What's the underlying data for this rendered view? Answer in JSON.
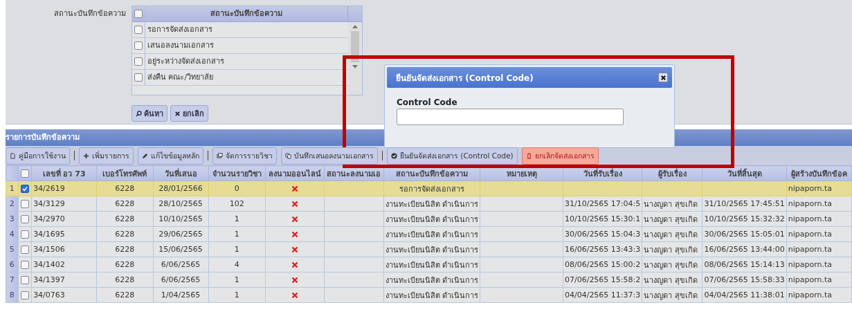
{
  "filter": {
    "label": "สถานะบันทึกข้อความ",
    "list_header": "สถานะบันทึกข้อความ",
    "header_checked": false,
    "options": [
      {
        "label": "รอการจัดส่งเอกสาร",
        "checked": false
      },
      {
        "label": "เสนอลงนามเอกสาร",
        "checked": false
      },
      {
        "label": "อยู่ระหว่างจัดส่งเอกสาร",
        "checked": false
      },
      {
        "label": "ส่งคืน คณะ/วิทยาลัย",
        "checked": false
      }
    ],
    "buttons": [
      {
        "label": "ค้นหา"
      },
      {
        "label": "ยกเลิก"
      }
    ]
  },
  "grid": {
    "title": "รายการบันทึกข้อความ",
    "toolbar": [
      {
        "kind": "button",
        "label": "คู่มือการใช้งาน"
      },
      {
        "kind": "separator"
      },
      {
        "kind": "button",
        "label": "เพิ่มรายการ"
      },
      {
        "kind": "button",
        "label": "แก้ไขข้อมูลหลัก"
      },
      {
        "kind": "separator"
      },
      {
        "kind": "button",
        "label": "จัดการรายวิชา"
      },
      {
        "kind": "button",
        "label": "บันทึกเสนอลงนามเอกสาร"
      },
      {
        "kind": "separator"
      },
      {
        "kind": "button",
        "label": "ยืนยันจัดส่งเอกสาร (Control Code)"
      },
      {
        "kind": "danger",
        "label": "ยกเลิกจัดส่งเอกสาร"
      }
    ],
    "header_checked": false,
    "columns": [
      "เลขที่ อว 73",
      "เบอร์โทรศัพท์",
      "วันที่เสนอ",
      "จำนวนรายวิชา",
      "ลงนามออนไลน์",
      "สถานะลงนามเอ",
      "สถานะบันทึกข้อความ",
      "หมายเหตุ",
      "วันที่รับเรื่อง",
      "ผู้รับเรื่อง",
      "วันที่สิ้นสุด",
      "ผู้สร้างบันทึกข้อค"
    ],
    "rows": [
      {
        "num": "1",
        "selected": true,
        "checked": true,
        "doc_no": "34/2619",
        "phone": "6228",
        "date": "28/01/2566",
        "count": "0",
        "signed_online": false,
        "status": "รอการจัดส่งเอกสาร",
        "creator": "nipaporn.ta"
      },
      {
        "num": "2",
        "selected": false,
        "checked": false,
        "doc_no": "34/3129",
        "phone": "6228",
        "date": "28/10/2565",
        "count": "102",
        "signed_online": false,
        "status": "งานทะเบียนนิสิต ดำเนินการ",
        "received": "31/10/2565 17:04:5",
        "receiver": "นางญดา สุขเกิด",
        "end": "31/10/2565 17:45:51",
        "creator": "nipaporn.ta"
      },
      {
        "num": "3",
        "selected": false,
        "checked": false,
        "doc_no": "34/2970",
        "phone": "6228",
        "date": "10/10/2565",
        "count": "1",
        "signed_online": false,
        "status": "งานทะเบียนนิสิต ดำเนินการ",
        "received": "10/10/2565 15:30:1",
        "receiver": "นางญดา สุขเกิด",
        "end": "10/10/2565 15:32:32",
        "creator": "nipaporn.ta"
      },
      {
        "num": "4",
        "selected": false,
        "checked": false,
        "doc_no": "34/1695",
        "phone": "6228",
        "date": "29/06/2565",
        "count": "1",
        "signed_online": false,
        "status": "งานทะเบียนนิสิต ดำเนินการ",
        "received": "30/06/2565 15:04:3",
        "receiver": "นางญดา สุขเกิด",
        "end": "30/06/2565 15:05:01",
        "creator": "nipaporn.ta"
      },
      {
        "num": "5",
        "selected": false,
        "checked": false,
        "doc_no": "34/1506",
        "phone": "6228",
        "date": "15/06/2565",
        "count": "1",
        "signed_online": false,
        "status": "งานทะเบียนนิสิต ดำเนินการ",
        "received": "16/06/2565 13:43:3",
        "receiver": "นางญดา สุขเกิด",
        "end": "16/06/2565 13:44:00",
        "creator": "nipaporn.ta"
      },
      {
        "num": "6",
        "selected": false,
        "checked": false,
        "doc_no": "34/1402",
        "phone": "6228",
        "date": "6/06/2565",
        "count": "4",
        "signed_online": false,
        "status": "งานทะเบียนนิสิต ดำเนินการ",
        "received": "08/06/2565 15:00:2",
        "receiver": "นางญดา สุขเกิด",
        "end": "08/06/2565 15:14:13",
        "creator": "nipaporn.ta"
      },
      {
        "num": "7",
        "selected": false,
        "checked": false,
        "doc_no": "34/1397",
        "phone": "6228",
        "date": "6/06/2565",
        "count": "1",
        "signed_online": false,
        "status": "งานทะเบียนนิสิต ดำเนินการ",
        "received": "07/06/2565 15:58:2",
        "receiver": "นางญดา สุขเกิด",
        "end": "07/06/2565 15:58:33",
        "creator": "nipaporn.ta"
      },
      {
        "num": "8",
        "selected": false,
        "checked": false,
        "doc_no": "34/0763",
        "phone": "6228",
        "date": "1/04/2565",
        "count": "1",
        "signed_online": false,
        "status": "งานทะเบียนนิสิต ดำเนินการ",
        "received": "04/04/2565 11:37:3",
        "receiver": "นางญดา สุขเกิด",
        "end": "04/04/2565 11:38:01",
        "creator": "nipaporn.ta"
      }
    ]
  },
  "dialog": {
    "title": "ยืนยันจัดส่งเอกสาร (Control Code)",
    "field_label": "Control Code"
  }
}
